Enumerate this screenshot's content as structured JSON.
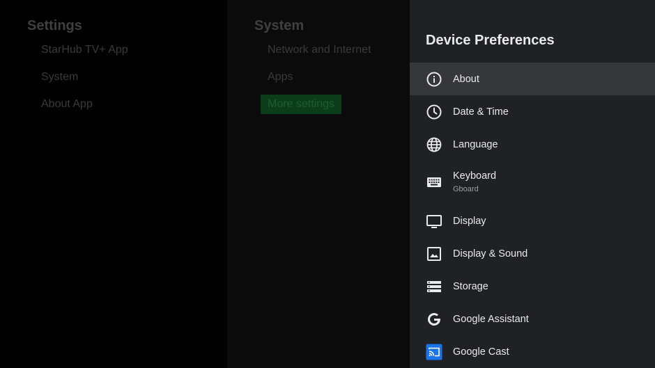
{
  "settings_column": {
    "title": "Settings",
    "items": [
      {
        "label": "StarHub TV+ App"
      },
      {
        "label": "System"
      },
      {
        "label": "About App"
      }
    ]
  },
  "system_column": {
    "title": "System",
    "items": [
      {
        "label": "Network and Internet"
      },
      {
        "label": "Apps"
      },
      {
        "label": "More settings"
      }
    ]
  },
  "device_preferences": {
    "title": "Device Preferences",
    "items": [
      {
        "label": "About",
        "icon": "info-icon"
      },
      {
        "label": "Date & Time",
        "icon": "clock-icon"
      },
      {
        "label": "Language",
        "icon": "globe-icon"
      },
      {
        "label": "Keyboard",
        "sublabel": "Gboard",
        "icon": "keyboard-icon"
      },
      {
        "label": "Display",
        "icon": "monitor-icon"
      },
      {
        "label": "Display & Sound",
        "icon": "image-icon"
      },
      {
        "label": "Storage",
        "icon": "storage-icon"
      },
      {
        "label": "Google Assistant",
        "icon": "google-g-icon"
      },
      {
        "label": "Google Cast",
        "icon": "cast-icon"
      }
    ]
  },
  "colors": {
    "panel_bg": "#202124",
    "selected_bg": "#36373a",
    "highlight_bg": "#0b3d1b",
    "cast_icon_bg": "#1a73e8"
  }
}
